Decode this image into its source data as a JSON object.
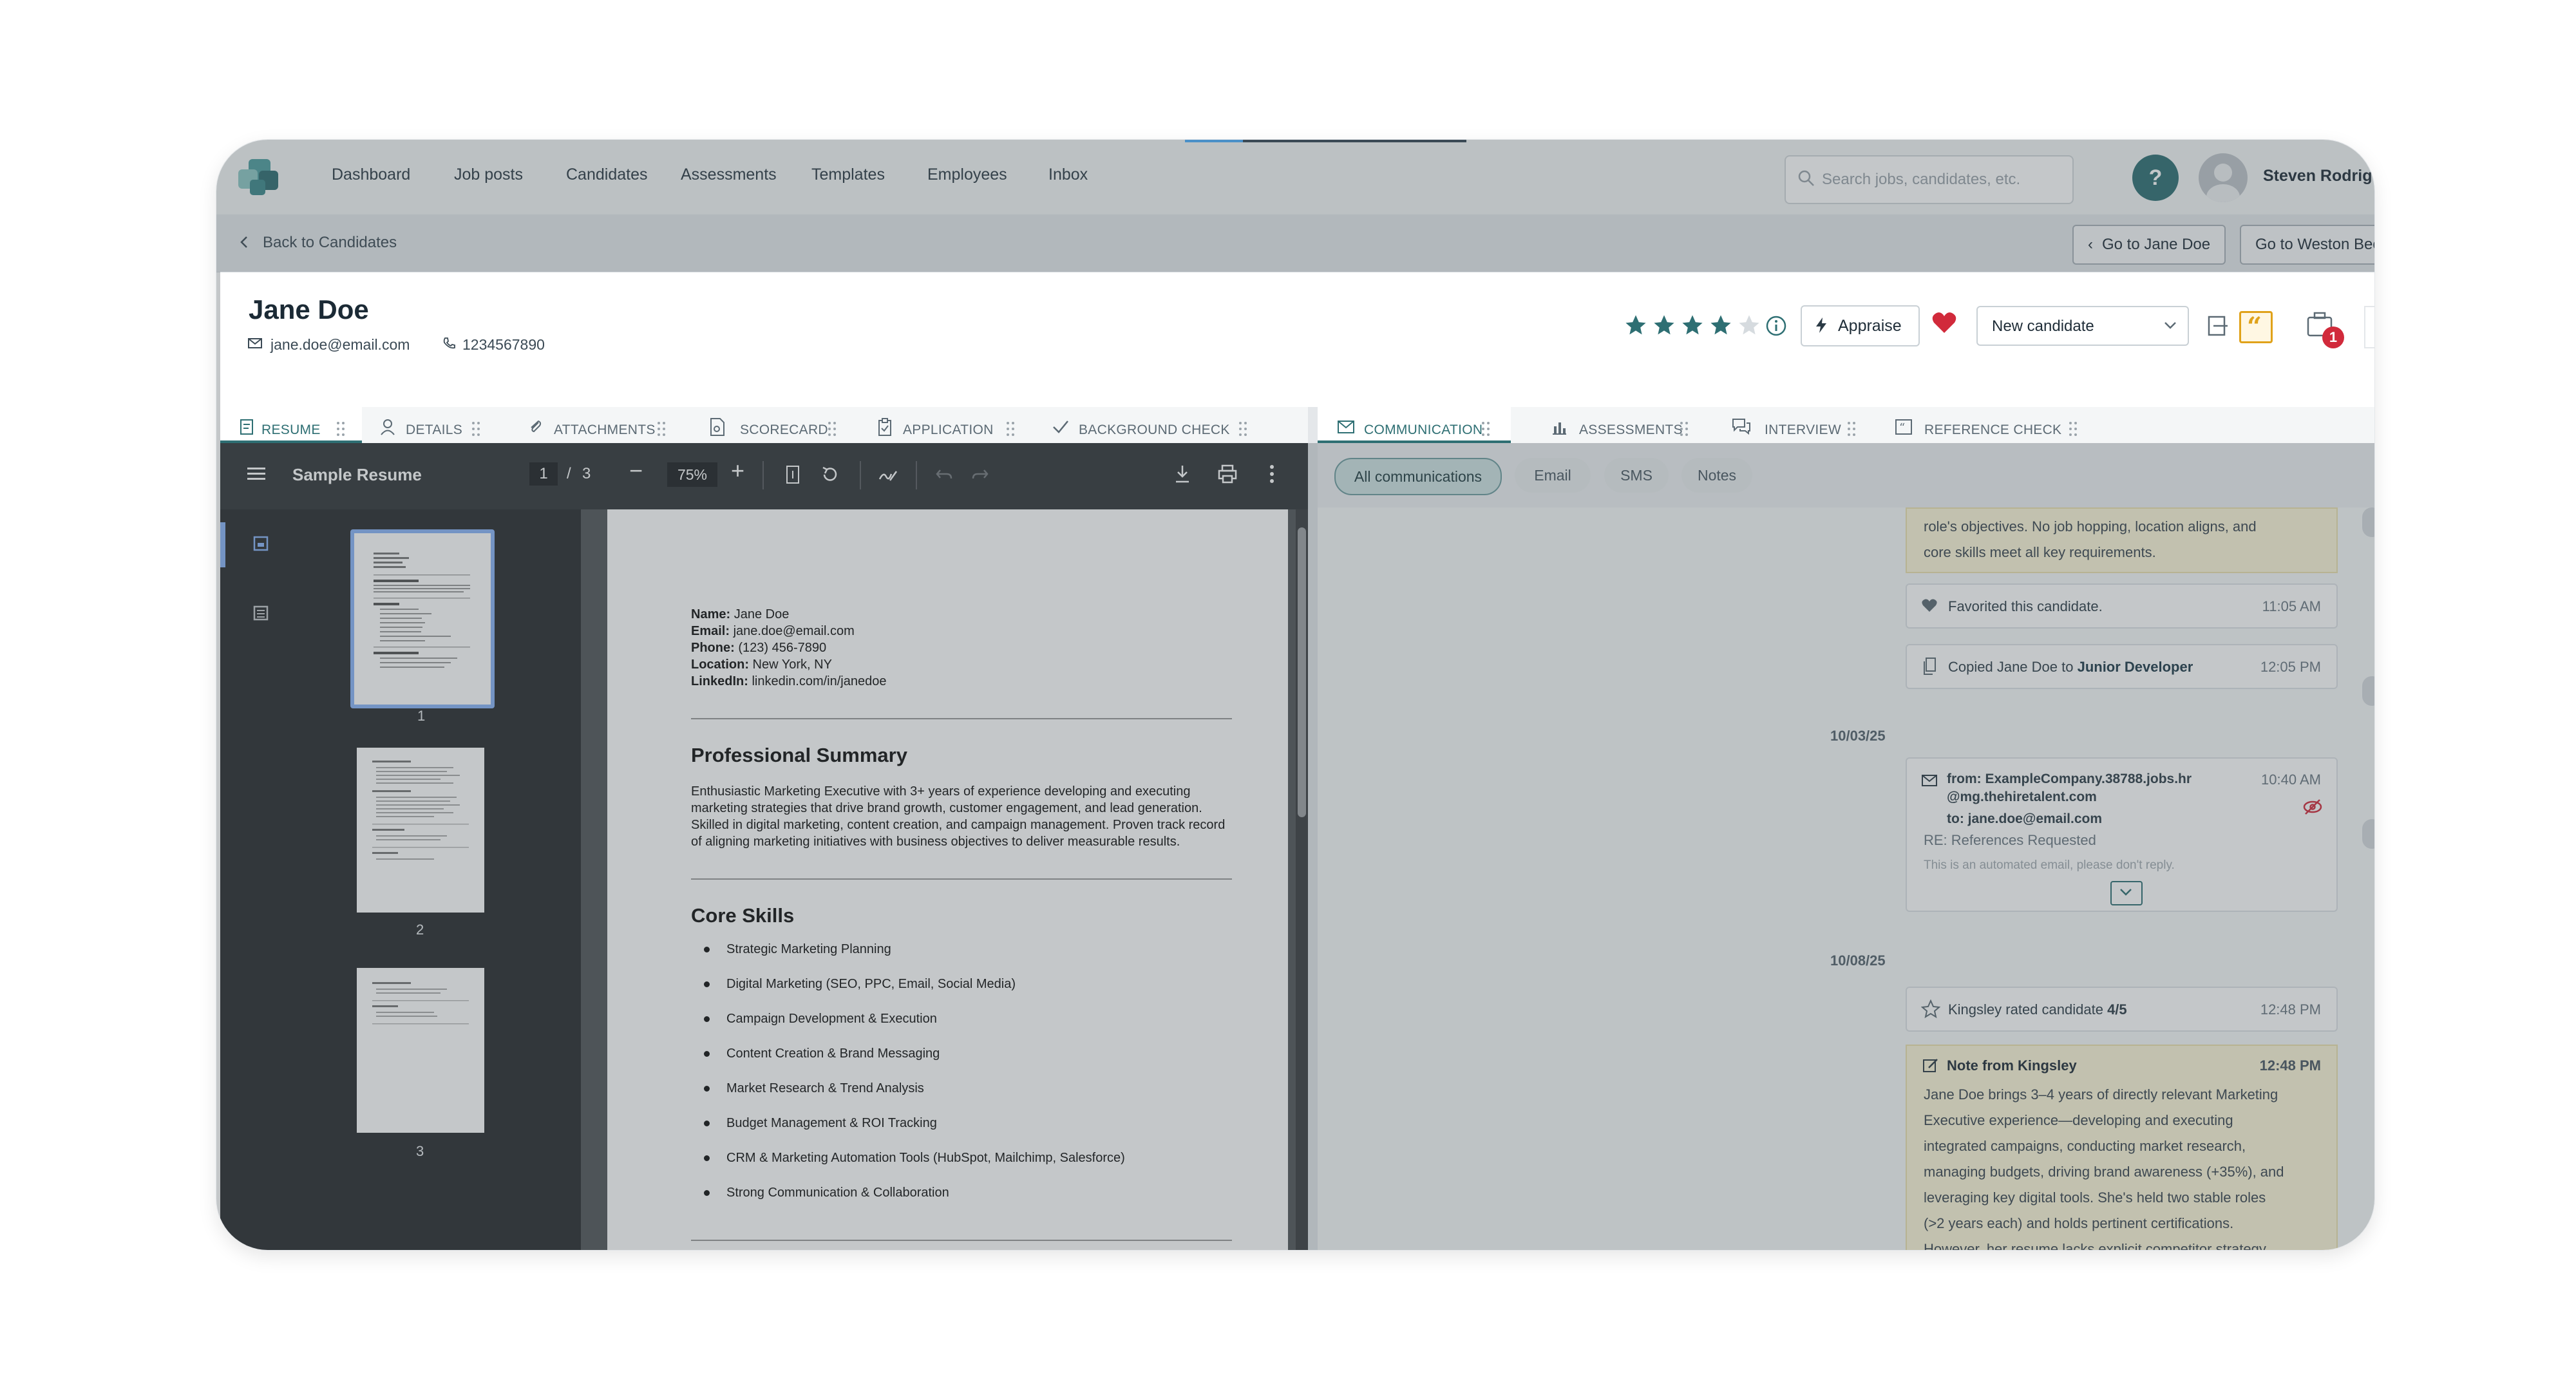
{
  "nav": {
    "items": [
      "Dashboard",
      "Job posts",
      "Candidates",
      "Assessments",
      "Templates",
      "Employees",
      "Inbox"
    ],
    "search_placeholder": "Search jobs, candidates, etc.",
    "help": "?",
    "user_name": "Steven Rodrigu"
  },
  "subnav": {
    "back": "Back to Candidates",
    "go_prev": "Go to Jane Doe",
    "go_next": "Go to Weston Bec"
  },
  "candidate": {
    "name": "Jane Doe",
    "email": "jane.doe@email.com",
    "phone": "1234567890",
    "rating": 4,
    "rating_max": 5,
    "appraise": "Appraise",
    "status": "New candidate",
    "badge_count": "1"
  },
  "tabs_left": [
    "RESUME",
    "DETAILS",
    "ATTACHMENTS",
    "SCORECARD",
    "APPLICATION",
    "BACKGROUND CHECK"
  ],
  "tabs_right": [
    "COMMUNICATION",
    "ASSESSMENTS",
    "INTERVIEW",
    "REFERENCE CHECK"
  ],
  "viewer": {
    "title": "Sample Resume",
    "page": "1",
    "pages": "3",
    "zoom": "75%",
    "thumb_labels": [
      "1",
      "2",
      "3"
    ]
  },
  "resume": {
    "contact": [
      {
        "label": "Name:",
        "value": " Jane Doe"
      },
      {
        "label": "Email:",
        "value": " jane.doe@email.com"
      },
      {
        "label": "Phone:",
        "value": " (123) 456-7890"
      },
      {
        "label": "Location:",
        "value": " New York, NY"
      },
      {
        "label": "LinkedIn:",
        "value": " linkedin.com/in/janedoe"
      }
    ],
    "summary_heading": "Professional Summary",
    "summary_lines": [
      "Enthusiastic Marketing Executive with 3+ years of experience developing and executing",
      "marketing strategies that drive brand growth, customer engagement, and lead generation.",
      "Skilled in digital marketing, content creation, and campaign management. Proven track record",
      "of aligning marketing initiatives with business objectives to deliver measurable results."
    ],
    "skills_heading": "Core Skills",
    "skills": [
      "Strategic Marketing Planning",
      "Digital Marketing (SEO, PPC, Email, Social Media)",
      "Campaign Development & Execution",
      "Content Creation & Brand Messaging",
      "Market Research & Trend Analysis",
      "Budget Management & ROI Tracking",
      "CRM & Marketing Automation Tools (HubSpot, Mailchimp, Salesforce)",
      "Strong Communication & Collaboration"
    ]
  },
  "comm": {
    "filters": [
      "All communications",
      "Email",
      "SMS",
      "Notes"
    ],
    "top_note_lines": [
      "role's objectives. No job hopping, location aligns, and",
      "core skills meet all key requirements."
    ],
    "favorited": {
      "text": "Favorited this candidate.",
      "time": "11:05 AM"
    },
    "copied": {
      "text_prefix": "Copied Jane Doe to ",
      "job": "Junior Developer",
      "time": "12:05 PM"
    },
    "date1": "10/03/25",
    "email": {
      "from_line1": "from: ExampleCompany.38788.jobs.hr",
      "from_line2": "@mg.thehiretalent.com",
      "to": "to: jane.doe@email.com",
      "time": "10:40 AM",
      "subject": "RE: References Requested",
      "preview": "This is an automated email, please don't reply."
    },
    "date2": "10/08/25",
    "rated": {
      "text_prefix": "Kingsley rated candidate ",
      "score": "4/5",
      "time": "12:48 PM"
    },
    "note": {
      "title": "Note from Kingsley",
      "time": "12:48 PM",
      "lines": [
        "Jane Doe brings 3–4 years of directly relevant Marketing",
        "Executive experience—developing and executing",
        "integrated campaigns, conducting market research,",
        "managing budgets, driving brand awareness (+35%), and",
        "leveraging key digital tools. She's held two stable roles",
        "(>2 years each) and holds pertinent certifications.",
        "However, her resume lacks explicit competitor strategy,"
      ]
    }
  }
}
